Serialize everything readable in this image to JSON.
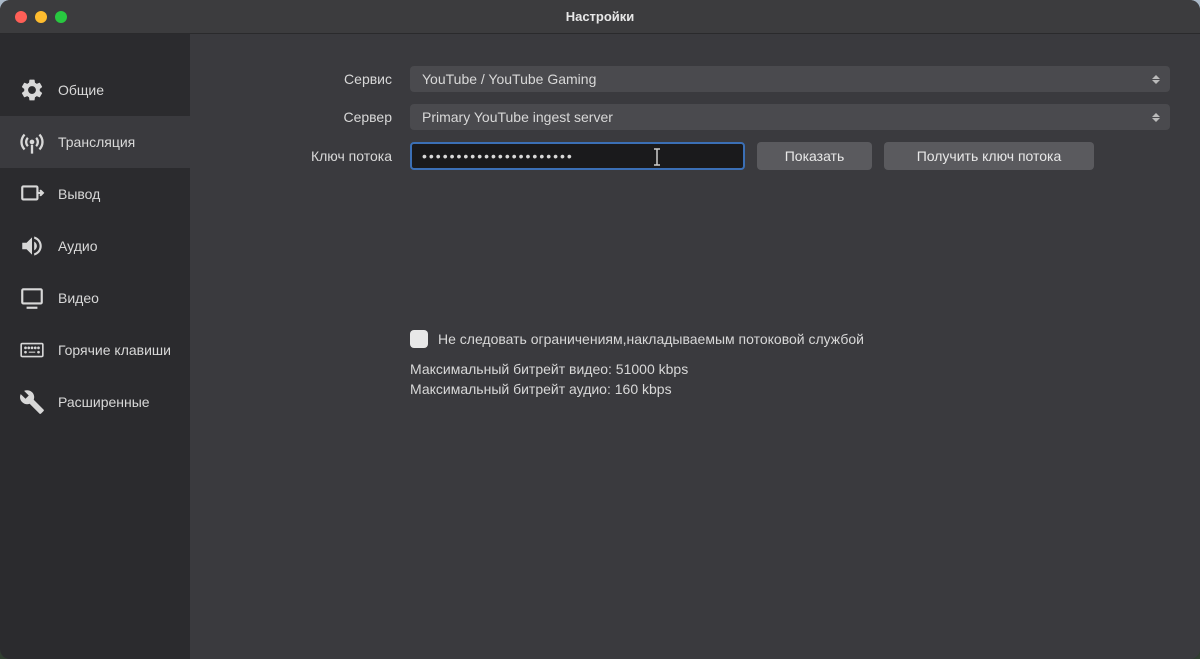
{
  "window": {
    "title": "Настройки"
  },
  "sidebar": {
    "items": [
      {
        "label": "Общие"
      },
      {
        "label": "Трансляция"
      },
      {
        "label": "Вывод"
      },
      {
        "label": "Аудио"
      },
      {
        "label": "Видео"
      },
      {
        "label": "Горячие клавиши"
      },
      {
        "label": "Расширенные"
      }
    ]
  },
  "form": {
    "service_label": "Сервис",
    "service_value": "YouTube / YouTube Gaming",
    "server_label": "Сервер",
    "server_value": "Primary YouTube ingest server",
    "streamkey_label": "Ключ потока",
    "streamkey_value": "••••••••••••••••••••••",
    "show_btn": "Показать",
    "getkey_btn": "Получить ключ потока"
  },
  "settings": {
    "ignore_limits_label": "Не следовать ограничениям,накладываемым потоковой службой",
    "max_video_bitrate": "Максимальный битрейт видео: 51000 kbps",
    "max_audio_bitrate": "Максимальный битрейт аудио: 160 kbps"
  }
}
